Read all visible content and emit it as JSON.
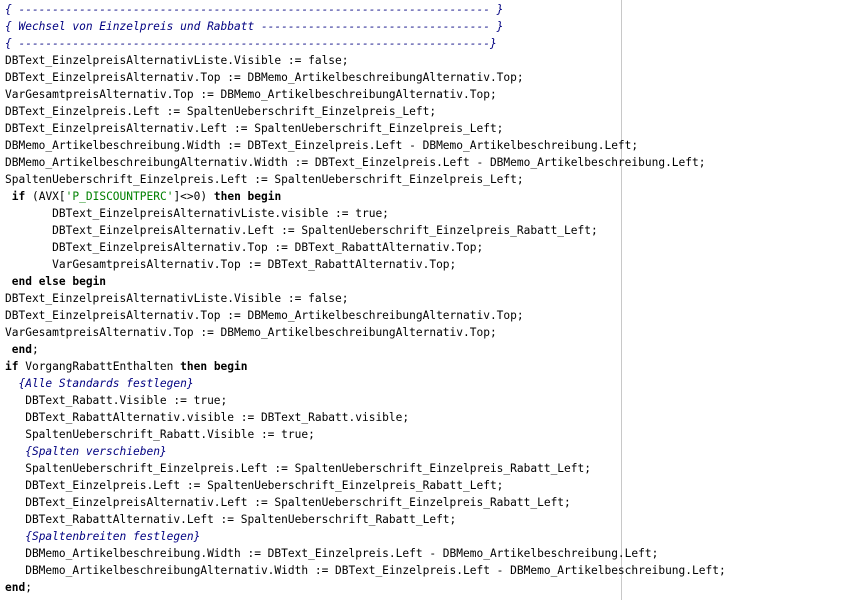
{
  "lines": [
    [
      {
        "t": "{ ---------------------------------------------------------------------- }",
        "c": "c"
      }
    ],
    [
      {
        "t": "{ Wechsel von Einzelpreis und Rabbatt ---------------------------------- }",
        "c": "c"
      }
    ],
    [
      {
        "t": "{ ----------------------------------------------------------------------}",
        "c": "c"
      }
    ],
    [
      {
        "t": "DBText_EinzelpreisAlternativListe.Visible := false;"
      }
    ],
    [
      {
        "t": "DBText_EinzelpreisAlternativ.Top := DBMemo_ArtikelbeschreibungAlternativ.Top;"
      }
    ],
    [
      {
        "t": "VarGesamtpreisAlternativ.Top := DBMemo_ArtikelbeschreibungAlternativ.Top;"
      }
    ],
    [
      {
        "t": "DBText_Einzelpreis.Left := SpaltenUeberschrift_Einzelpreis_Left;"
      }
    ],
    [
      {
        "t": "DBText_EinzelpreisAlternativ.Left := SpaltenUeberschrift_Einzelpreis_Left;"
      }
    ],
    [
      {
        "t": "DBMemo_Artikelbeschreibung.Width := DBText_Einzelpreis.Left - DBMemo_Artikelbeschreibung.Left;"
      }
    ],
    [
      {
        "t": "DBMemo_ArtikelbeschreibungAlternativ.Width := DBText_Einzelpreis.Left - DBMemo_Artikelbeschreibung.Left;"
      }
    ],
    [
      {
        "t": "SpaltenUeberschrift_Einzelpreis.Left := SpaltenUeberschrift_Einzelpreis_Left;"
      }
    ],
    [
      {
        "t": " "
      },
      {
        "t": "if",
        "c": "k"
      },
      {
        "t": " (AVX["
      },
      {
        "t": "'P_DISCOUNTPERC'",
        "c": "s"
      },
      {
        "t": "]<>0) "
      },
      {
        "t": "then begin",
        "c": "k"
      }
    ],
    [
      {
        "t": "       DBText_EinzelpreisAlternativListe.visible := true;"
      }
    ],
    [
      {
        "t": "       DBText_EinzelpreisAlternativ.Left := SpaltenUeberschrift_Einzelpreis_Rabatt_Left;"
      }
    ],
    [
      {
        "t": "       DBText_EinzelpreisAlternativ.Top := DBText_RabattAlternativ.Top;"
      }
    ],
    [
      {
        "t": "       VarGesamtpreisAlternativ.Top := DBText_RabattAlternativ.Top;"
      }
    ],
    [
      {
        "t": " "
      },
      {
        "t": "end else begin",
        "c": "k"
      }
    ],
    [
      {
        "t": "DBText_EinzelpreisAlternativListe.Visible := false;"
      }
    ],
    [
      {
        "t": "DBText_EinzelpreisAlternativ.Top := DBMemo_ArtikelbeschreibungAlternativ.Top;"
      }
    ],
    [
      {
        "t": "VarGesamtpreisAlternativ.Top := DBMemo_ArtikelbeschreibungAlternativ.Top;"
      }
    ],
    [
      {
        "t": " "
      },
      {
        "t": "end",
        "c": "k"
      },
      {
        "t": ";"
      }
    ],
    [
      {
        "t": "if",
        "c": "k"
      },
      {
        "t": " VorgangRabattEnthalten "
      },
      {
        "t": "then begin",
        "c": "k"
      }
    ],
    [
      {
        "t": "  "
      },
      {
        "t": "{Alle Standards festlegen}",
        "c": "c"
      }
    ],
    [
      {
        "t": "   DBText_Rabatt.Visible := true;"
      }
    ],
    [
      {
        "t": "   DBText_RabattAlternativ.visible := DBText_Rabatt.visible;"
      }
    ],
    [
      {
        "t": "   SpaltenUeberschrift_Rabatt.Visible := true;"
      }
    ],
    [
      {
        "t": "   "
      },
      {
        "t": "{Spalten verschieben}",
        "c": "c"
      }
    ],
    [
      {
        "t": "   SpaltenUeberschrift_Einzelpreis.Left := SpaltenUeberschrift_Einzelpreis_Rabatt_Left;"
      }
    ],
    [
      {
        "t": "   DBText_Einzelpreis.Left := SpaltenUeberschrift_Einzelpreis_Rabatt_Left;"
      }
    ],
    [
      {
        "t": "   DBText_EinzelpreisAlternativ.Left := SpaltenUeberschrift_Einzelpreis_Rabatt_Left;"
      }
    ],
    [
      {
        "t": "   DBText_RabattAlternativ.Left := SpaltenUeberschrift_Rabatt_Left;"
      }
    ],
    [
      {
        "t": "   "
      },
      {
        "t": "{Spaltenbreiten festlegen}",
        "c": "c"
      }
    ],
    [
      {
        "t": "   DBMemo_Artikelbeschreibung.Width := DBText_Einzelpreis.Left - DBMemo_Artikelbeschreibung.Left;"
      }
    ],
    [
      {
        "t": "   DBMemo_ArtikelbeschreibungAlternativ.Width := DBText_Einzelpreis.Left - DBMemo_Artikelbeschreibung.Left;"
      }
    ],
    [
      {
        "t": "end",
        "c": "k"
      },
      {
        "t": ";"
      }
    ]
  ],
  "colors": {
    "comment": "#000080",
    "string": "#008000",
    "text": "#000000",
    "margin_line": "#c8c8c8"
  }
}
